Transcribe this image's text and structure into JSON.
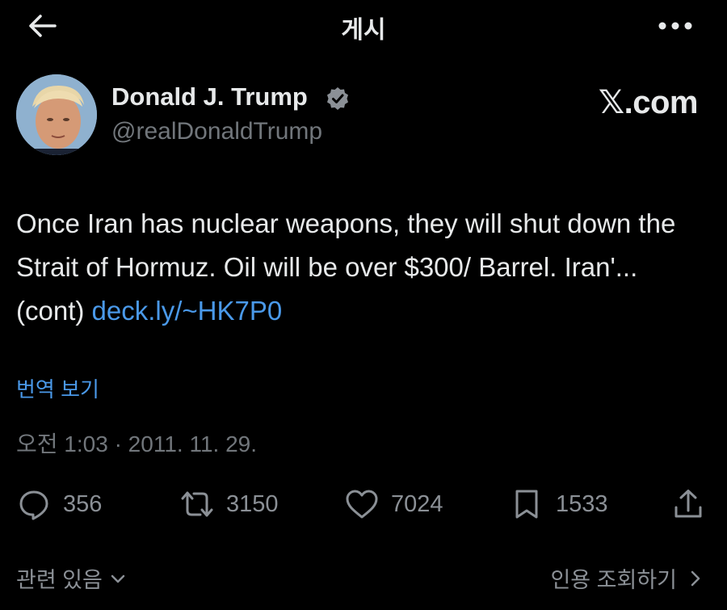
{
  "header": {
    "title": "게시",
    "back_icon": "arrow-left-icon",
    "more_icon": "more-dots-icon"
  },
  "author": {
    "name": "Donald J. Trump",
    "handle": "@realDonaldTrump",
    "verified": true,
    "badge_icon": "verified-badge-icon"
  },
  "branding": {
    "x_logo": "𝕏.com"
  },
  "tweet": {
    "text": "Once Iran has nuclear weapons, they will shut down the Strait of Hormuz.  Oil will be over $300/ Barrel. Iran'... (cont) ",
    "link": "deck.ly/~HK7P0",
    "translate_label": "번역 보기",
    "timestamp": "오전 1:03 · 2011. 11. 29."
  },
  "actions": {
    "reply": {
      "icon": "reply-icon",
      "count": "356"
    },
    "retweet": {
      "icon": "retweet-icon",
      "count": "3150"
    },
    "like": {
      "icon": "heart-icon",
      "count": "7024"
    },
    "bookmark": {
      "icon": "bookmark-icon",
      "count": "1533"
    },
    "share": {
      "icon": "share-icon"
    }
  },
  "footer": {
    "related_label": "관련 있음",
    "quotes_label": "인용 조회하기"
  },
  "colors": {
    "background": "#000000",
    "text": "#e7e9ea",
    "muted": "#71767b",
    "link": "#4a99e9"
  }
}
